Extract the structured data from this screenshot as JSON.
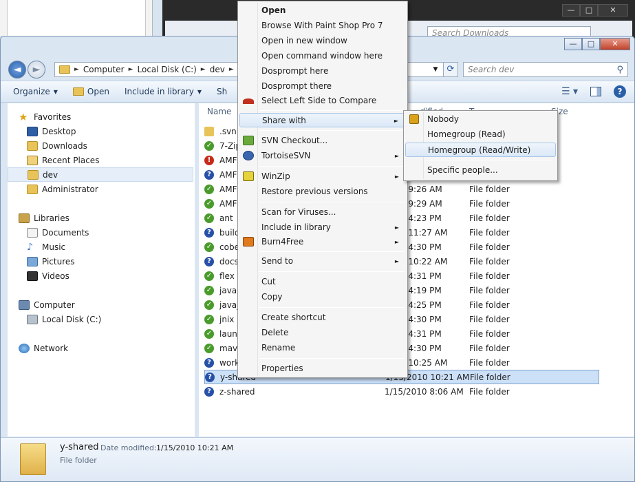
{
  "background": {
    "caption_minimize": "—",
    "caption_maximize": "□",
    "caption_close": "✕",
    "search_placeholder": "Search Downloads"
  },
  "window": {
    "caption_minimize": "—",
    "caption_maximize": "□",
    "caption_close": "✕"
  },
  "address": {
    "back": "◄",
    "forward": "►",
    "crumbs": [
      "Computer",
      "Local Disk (C:)",
      "dev"
    ],
    "separator": "►",
    "dropdown": "▼",
    "refresh": "⟳",
    "search_placeholder": "Search dev",
    "search_icon": "⚲"
  },
  "toolbar": {
    "organize": "Organize",
    "open": "Open",
    "include": "Include in library",
    "share": "Sh",
    "caret": "▼"
  },
  "nav": {
    "favorites": "Favorites",
    "desktop": "Desktop",
    "downloads": "Downloads",
    "recent": "Recent Places",
    "dev": "dev",
    "administrator": "Administrator",
    "libraries": "Libraries",
    "documents": "Documents",
    "music": "Music",
    "pictures": "Pictures",
    "videos": "Videos",
    "computer": "Computer",
    "local_disk": "Local Disk (C:)",
    "network": "Network"
  },
  "columns": {
    "name": "Name",
    "date": "...dified",
    "type": "T...",
    "size": "Size"
  },
  "files": [
    {
      "name": ".svn",
      "date": "",
      "type": "",
      "status": "plain"
    },
    {
      "name": "7-Zip",
      "date": "",
      "type": "",
      "status": "ok"
    },
    {
      "name": "AMF",
      "date": "",
      "type": "",
      "status": "err"
    },
    {
      "name": "AMF",
      "date": "",
      "type": "",
      "status": "q"
    },
    {
      "name": "AMF",
      "date": "2010 9:26 AM",
      "type": "File folder",
      "status": "ok"
    },
    {
      "name": "AMF",
      "date": "2010 9:29 AM",
      "type": "File folder",
      "status": "ok"
    },
    {
      "name": "ant",
      "date": "2010 4:23 PM",
      "type": "File folder",
      "status": "ok"
    },
    {
      "name": "build",
      "date": "2010 11:27 AM",
      "type": "File folder",
      "status": "q"
    },
    {
      "name": "cobe",
      "date": "2010 4:30 PM",
      "type": "File folder",
      "status": "ok"
    },
    {
      "name": "docs",
      "date": "2010 10:22 AM",
      "type": "File folder",
      "status": "q"
    },
    {
      "name": "flex",
      "date": "2010 4:31 PM",
      "type": "File folder",
      "status": "ok"
    },
    {
      "name": "java",
      "date": "2010 4:19 PM",
      "type": "File folder",
      "status": "ok"
    },
    {
      "name": "java_",
      "date": "2010 4:25 PM",
      "type": "File folder",
      "status": "ok"
    },
    {
      "name": "jnix",
      "date": "2010 4:30 PM",
      "type": "File folder",
      "status": "ok"
    },
    {
      "name": "laun",
      "date": "2010 4:31 PM",
      "type": "File folder",
      "status": "ok"
    },
    {
      "name": "mav",
      "date": "2010 4:30 PM",
      "type": "File folder",
      "status": "ok"
    },
    {
      "name": "work",
      "date": "2010 10:25 AM",
      "type": "File folder",
      "status": "q"
    },
    {
      "name": "y-shared",
      "date": "1/15/2010 10:21 AM",
      "type": "File folder",
      "status": "q"
    },
    {
      "name": "z-shared",
      "date": "1/15/2010 8:06 AM",
      "type": "File folder",
      "status": "q"
    }
  ],
  "details": {
    "name": "y-shared",
    "date_label": "Date modified:",
    "date": "1/15/2010 10:21 AM",
    "type": "File folder"
  },
  "context_menu": {
    "open": "Open",
    "browse_psp": "Browse With Paint Shop Pro 7",
    "open_new_window": "Open in new window",
    "open_cmd": "Open command window here",
    "dosprompt_here": "Dosprompt here",
    "dosprompt_there": "Dosprompt there",
    "select_left": "Select Left Side to Compare",
    "share_with": "Share with",
    "svn_checkout": "SVN Checkout...",
    "tortoise": "TortoiseSVN",
    "winzip": "WinZip",
    "restore": "Restore previous versions",
    "scan": "Scan for Viruses...",
    "include": "Include in library",
    "burn": "Burn4Free",
    "send_to": "Send to",
    "cut": "Cut",
    "copy": "Copy",
    "create_shortcut": "Create shortcut",
    "delete": "Delete",
    "rename": "Rename",
    "properties": "Properties",
    "arrow": "►"
  },
  "share_submenu": {
    "nobody": "Nobody",
    "homegroup_read": "Homegroup (Read)",
    "homegroup_rw": "Homegroup (Read/Write)",
    "specific": "Specific people..."
  }
}
